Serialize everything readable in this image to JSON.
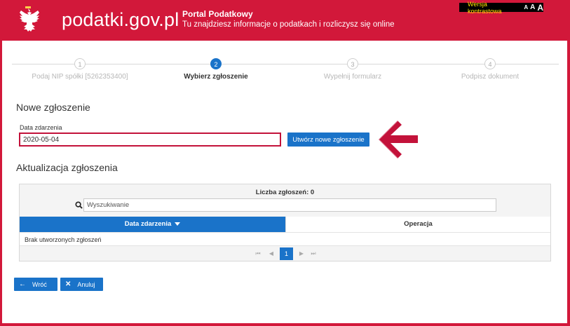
{
  "header": {
    "site_title": "podatki.gov.pl",
    "portal_name": "Portal Podatkowy",
    "tagline": "Tu znajdziesz informacje o podatkach i rozliczysz się online",
    "contrast_label": "Wersja kontrastowa",
    "font_size_labels": [
      "A",
      "A",
      "A"
    ]
  },
  "steps": [
    {
      "number": "1",
      "label": "Podaj NIP spółki [5262353400]"
    },
    {
      "number": "2",
      "label": "Wybierz zgłoszenie"
    },
    {
      "number": "3",
      "label": "Wypełnij formularz"
    },
    {
      "number": "4",
      "label": "Podpisz dokument"
    }
  ],
  "active_step": 2,
  "new_report": {
    "title": "Nowe zgłoszenie",
    "date_label": "Data zdarzenia",
    "date_value": "2020-05-04",
    "create_button": "Utwórz nowe zgłoszenie"
  },
  "update_section": {
    "title": "Aktualizacja zgłoszenia",
    "count_label": "Liczba zgłoszeń: 0",
    "search_placeholder": "Wyszukiwanie",
    "columns": [
      "Data zdarzenia",
      "Operacja"
    ],
    "empty_message": "Brak utworzonych zgłoszeń",
    "pagination": {
      "first": "⏮",
      "prev": "◀",
      "current": "1",
      "next": "▶",
      "last": "⏭"
    }
  },
  "footer_buttons": {
    "back": "Wróć",
    "cancel": "Anuluj"
  },
  "colors": {
    "brand_red": "#d2183a",
    "primary_blue": "#1a73c9",
    "arrow_red": "#c3123a"
  }
}
